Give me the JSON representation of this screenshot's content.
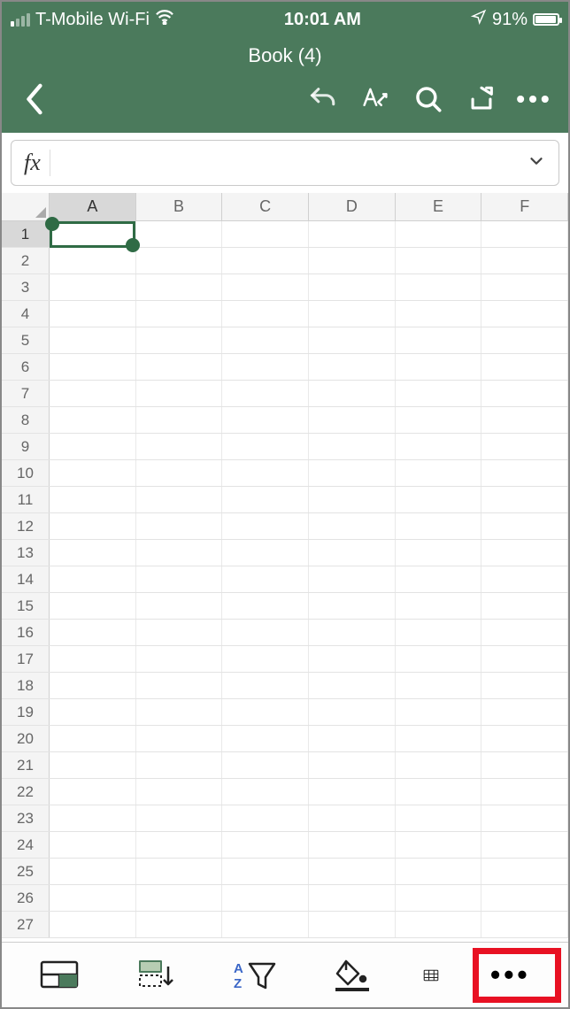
{
  "status": {
    "carrier": "T-Mobile Wi-Fi",
    "time": "10:01 AM",
    "battery_pct": "91%"
  },
  "header": {
    "title": "Book (4)"
  },
  "formula": {
    "label": "fx",
    "value": ""
  },
  "grid": {
    "columns": [
      "A",
      "B",
      "C",
      "D",
      "E",
      "F"
    ],
    "rows": [
      "1",
      "2",
      "3",
      "4",
      "5",
      "6",
      "7",
      "8",
      "9",
      "10",
      "11",
      "12",
      "13",
      "14",
      "15",
      "16",
      "17",
      "18",
      "19",
      "20",
      "21",
      "22",
      "23",
      "24",
      "25",
      "26",
      "27"
    ],
    "selected_col": "A",
    "selected_row": "1"
  },
  "toolbar_icons": {
    "back": "back",
    "undo": "undo",
    "style": "text-style",
    "search": "search",
    "share": "share",
    "more": "•••"
  },
  "bottom_icons": {
    "card": "card-view",
    "insert": "insert-rows",
    "sort": "sort-filter",
    "fill": "fill-color",
    "table": "table-partial",
    "more": "•••"
  }
}
